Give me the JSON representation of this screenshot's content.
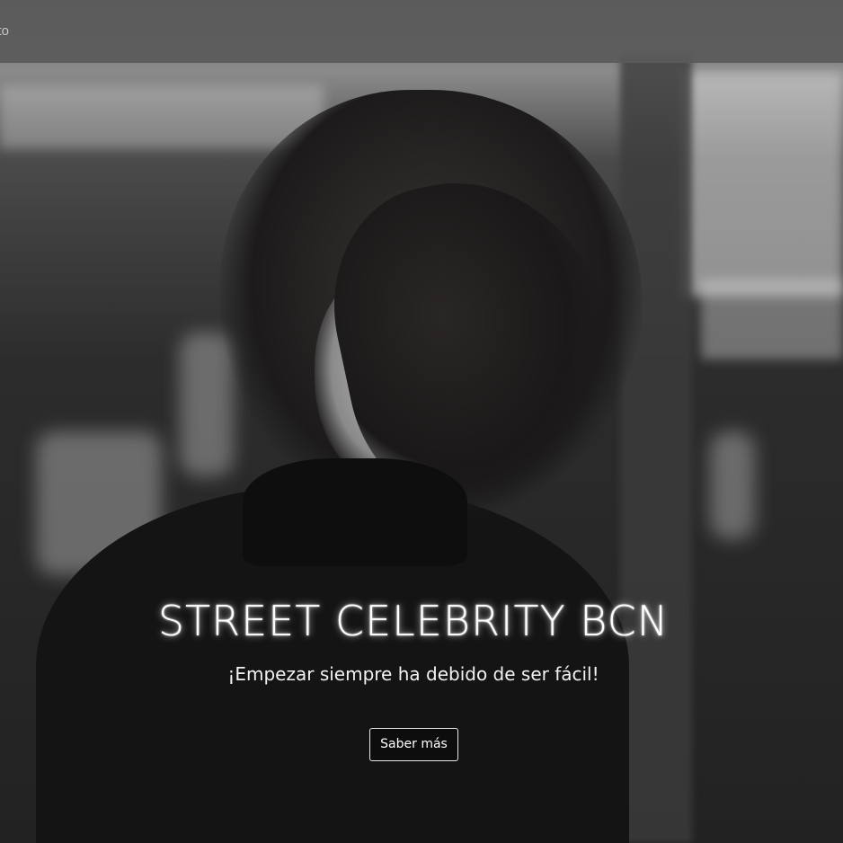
{
  "navbar": {
    "partial_link_label": "cto"
  },
  "hero": {
    "title": "STREET CELEBRITY BCN",
    "subtitle": "¡Empezar siempre ha debido de ser fácil!",
    "cta_label": "Saber más",
    "image_tone": "grayscale"
  },
  "colors": {
    "navbar_bg": "#5a5a5a",
    "text": "#ffffff",
    "button_border": "#e6e6e6"
  }
}
